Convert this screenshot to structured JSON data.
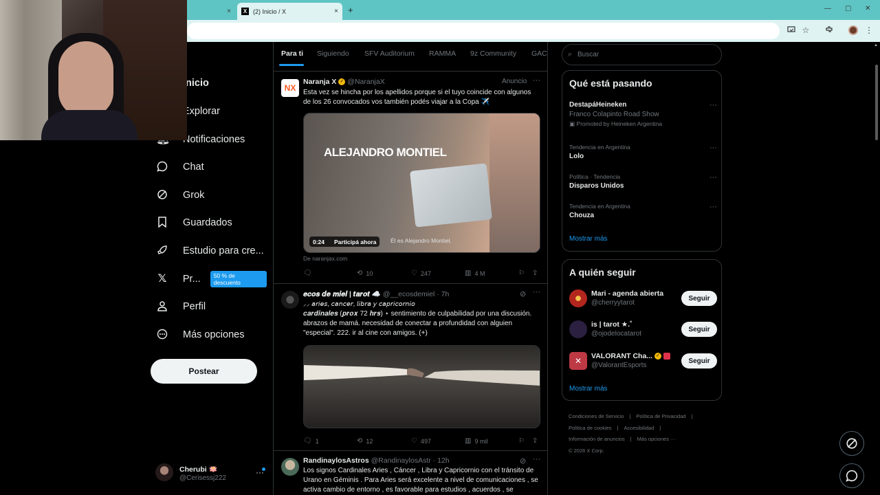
{
  "browser": {
    "tabs": [
      {
        "title": "",
        "active": false
      },
      {
        "title": "(2) Inicio / X",
        "active": true
      }
    ],
    "new_tab": "+",
    "close_glyph": "×",
    "window_controls": [
      "—",
      "▢",
      "✕"
    ]
  },
  "nav": {
    "items": [
      {
        "label": "Inicio",
        "icon": "home-icon"
      },
      {
        "label": "Explorar",
        "icon": "search-icon"
      },
      {
        "label": "Notificaciones",
        "icon": "bell-icon"
      },
      {
        "label": "Chat",
        "icon": "chat-icon"
      },
      {
        "label": "Grok",
        "icon": "grok-icon"
      },
      {
        "label": "Guardados",
        "icon": "bookmark-icon"
      },
      {
        "label": "Estudio para cre...",
        "icon": "rocket-icon"
      },
      {
        "label": "Pr...",
        "icon": "x-logo-icon",
        "badge": "50 % de descuento"
      },
      {
        "label": "Perfil",
        "icon": "person-icon"
      },
      {
        "label": "Más opciones",
        "icon": "more-circle-icon"
      }
    ],
    "post_button": "Postear",
    "me": {
      "name": "Cherubi 🪷",
      "handle": "@Cerisessj222",
      "more": "···"
    }
  },
  "feed": {
    "tabs": [
      "Para ti",
      "Siguiendo",
      "SFV Auditorium",
      "RAMMA",
      "9z Community",
      "GACI"
    ],
    "posts": [
      {
        "author": "Naranja X",
        "handle": "@NaranjaX",
        "meta": "Anuncio",
        "text": "Esta vez se hincha por los apellidos porque si el tuyo coincide con algunos de los 26 convocados vos también podés viajar a la Copa ✈️",
        "media": {
          "overlay_title": "ALEJANDRO MONTIEL",
          "duration": "0:24",
          "cta": "Participá ahora",
          "caption": "Él es Alejandro Montiel."
        },
        "source": "De naranjax.com",
        "stats": {
          "replies": "",
          "reposts": "10",
          "likes": "247",
          "views": "4 M"
        }
      },
      {
        "author": "𝒆𝒄𝒐𝒔 𝒅𝒆 𝒎𝒊𝒆𝒍 | 𝒕𝒂𝒓𝒐𝒕 ☁️",
        "handle": "@__ecosdemiel",
        "meta": "· 7h",
        "line1": "⸝⸝ 𝘢𝘳𝘪𝘦𝘴, 𝘤𝘢𝘯𝘤𝘦𝘳, 𝘭𝘪𝘣𝘳𝘢 𝘺 𝘤𝘢𝘱𝘳𝘪𝘤𝘰𝘳𝘯𝘪𝘰",
        "line2_em": "𝒄𝒂𝒓𝒅𝒊𝒏𝒂𝒍𝒆𝒔 (𝒑𝒓𝒐𝒙 72 𝒉𝒓𝒔)",
        "line2_rest": " ⋆ sentimiento de culpabilidad por una discusión. abrazos de mamá. necesidad de conectar a profundidad con alguien \"especial\". 222. ir al cine con amigos. (+)",
        "stats": {
          "replies": "1",
          "reposts": "12",
          "likes": "497",
          "views": "9 mil"
        }
      },
      {
        "author": "RandinaylosAstros",
        "handle": "@RandinaylosAstr",
        "meta": "· 12h",
        "text": "Los signos Cardinales Aries , Cáncer , Libra y Capricornio con el tránsito de Urano en Géminis . Para Aries será excelente a nivel de comunicaciones , se activa cambio de entorno , es favorable para estudios , acuerdos , se"
      }
    ]
  },
  "right": {
    "search_placeholder": "Buscar",
    "trending_title": "Qué está pasando",
    "trends": [
      {
        "name": "DestapáHeineken",
        "sub": "Franco Colapinto Road Show",
        "promo": "Promoted by Heineken Argentina"
      },
      {
        "top": "Tendencia en Argentina",
        "name": "Lolo"
      },
      {
        "top": "Política · Tendencia",
        "name": "Disparos Unidos"
      },
      {
        "top": "Tendencia en Argentina",
        "name": "Chouza"
      }
    ],
    "show_more": "Mostrar más",
    "who_title": "A quién seguir",
    "who": [
      {
        "name": "Mari - agenda abierta",
        "handle": "@cherryytarot",
        "color": "#b3261e"
      },
      {
        "name": "is | tarot ★.˚",
        "handle": "@ojodelocatarot",
        "color": "#2b2040"
      },
      {
        "name": "VALORANT Cha...",
        "handle": "@ValorantEsports",
        "color": "#bd3944"
      }
    ],
    "follow_label": "Seguir",
    "footer": [
      "Condiciones de Servicio",
      "Política de Privacidad",
      "Política de cookies",
      "Accesibilidad",
      "Información de anuncios",
      "Más opciones ···",
      "© 2026 X Corp."
    ]
  },
  "colors": {
    "accent": "#1d9bf0",
    "tab_bar": "#5fc4c4",
    "background": "#000000"
  }
}
